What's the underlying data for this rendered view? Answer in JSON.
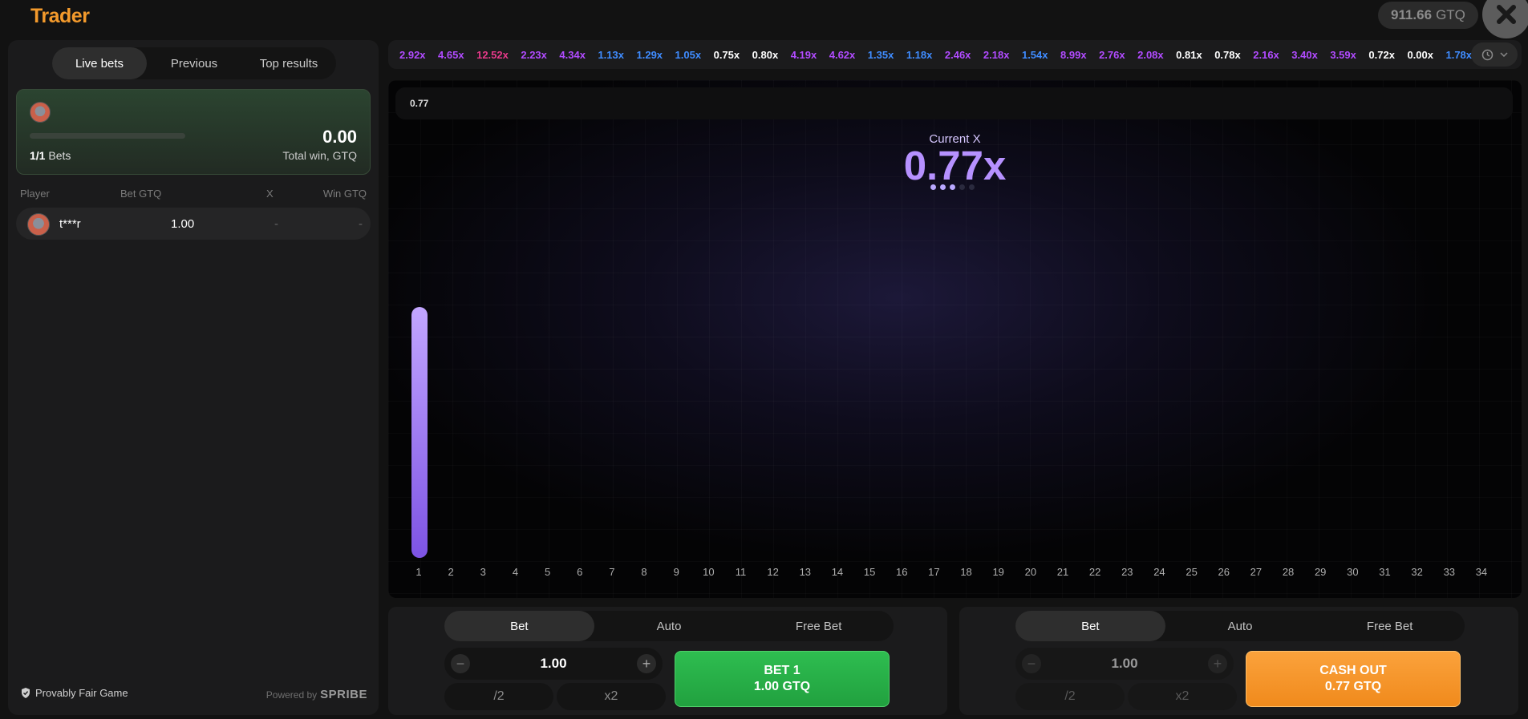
{
  "app": {
    "title": "Trader"
  },
  "header": {
    "balance_value": "911.66",
    "balance_currency": "GTQ",
    "close_icon": "close-icon"
  },
  "left": {
    "tabs": [
      {
        "label": "Live bets"
      },
      {
        "label": "Previous"
      },
      {
        "label": "Top results"
      }
    ],
    "summary": {
      "count": "1/1",
      "count_label": "Bets",
      "total": "0.00",
      "total_label": "Total win, GTQ"
    },
    "headers": {
      "player": "Player",
      "bet": "Bet GTQ",
      "x": "X",
      "win": "Win GTQ"
    },
    "rows": [
      {
        "player": "t***r",
        "bet": "1.00",
        "x": "-",
        "win": "-"
      }
    ],
    "footer": {
      "fair": "Provably Fair Game",
      "powered": "Powered by",
      "brand": "SPRIBE"
    }
  },
  "history": [
    {
      "v": "2.92x",
      "c": "#b14bff"
    },
    {
      "v": "4.65x",
      "c": "#b14bff"
    },
    {
      "v": "12.52x",
      "c": "#e8398a"
    },
    {
      "v": "2.23x",
      "c": "#b14bff"
    },
    {
      "v": "4.34x",
      "c": "#b14bff"
    },
    {
      "v": "1.13x",
      "c": "#3f8cff"
    },
    {
      "v": "1.29x",
      "c": "#3f8cff"
    },
    {
      "v": "1.05x",
      "c": "#3f8cff"
    },
    {
      "v": "0.75x",
      "c": "#ffffff"
    },
    {
      "v": "0.80x",
      "c": "#ffffff"
    },
    {
      "v": "4.19x",
      "c": "#b14bff"
    },
    {
      "v": "4.62x",
      "c": "#b14bff"
    },
    {
      "v": "1.35x",
      "c": "#3f8cff"
    },
    {
      "v": "1.18x",
      "c": "#3f8cff"
    },
    {
      "v": "2.46x",
      "c": "#b14bff"
    },
    {
      "v": "2.18x",
      "c": "#b14bff"
    },
    {
      "v": "1.54x",
      "c": "#3f8cff"
    },
    {
      "v": "8.99x",
      "c": "#b14bff"
    },
    {
      "v": "2.76x",
      "c": "#b14bff"
    },
    {
      "v": "2.08x",
      "c": "#b14bff"
    },
    {
      "v": "0.81x",
      "c": "#ffffff"
    },
    {
      "v": "0.78x",
      "c": "#ffffff"
    },
    {
      "v": "2.16x",
      "c": "#b14bff"
    },
    {
      "v": "3.40x",
      "c": "#b14bff"
    },
    {
      "v": "3.59x",
      "c": "#b14bff"
    },
    {
      "v": "0.72x",
      "c": "#ffffff"
    },
    {
      "v": "0.00x",
      "c": "#ffffff"
    },
    {
      "v": "1.78x",
      "c": "#3f8cff"
    }
  ],
  "game": {
    "top_value": "0.77",
    "current_label": "Current X",
    "current_value": "0.77x",
    "ticks": [
      "1",
      "2",
      "3",
      "4",
      "5",
      "6",
      "7",
      "8",
      "9",
      "10",
      "11",
      "12",
      "13",
      "14",
      "15",
      "16",
      "17",
      "18",
      "19",
      "20",
      "21",
      "22",
      "23",
      "24",
      "25",
      "26",
      "27",
      "28",
      "29",
      "30",
      "31",
      "32",
      "33",
      "34"
    ]
  },
  "panel1": {
    "tabs": [
      {
        "label": "Bet"
      },
      {
        "label": "Auto"
      },
      {
        "label": "Free Bet"
      }
    ],
    "amount": "1.00",
    "half": "/2",
    "double": "x2",
    "action_line1": "BET 1",
    "action_line2": "1.00 GTQ"
  },
  "panel2": {
    "tabs": [
      {
        "label": "Bet"
      },
      {
        "label": "Auto"
      },
      {
        "label": "Free Bet"
      }
    ],
    "amount": "1.00",
    "half": "/2",
    "double": "x2",
    "action_line1": "CASH OUT",
    "action_line2": "0.77 GTQ"
  },
  "colors": {
    "accent": "#f39a2c",
    "bet_green": "#28b04a",
    "cashout_orange": "#f7951f",
    "multiplier_purple": "#b691ff"
  }
}
